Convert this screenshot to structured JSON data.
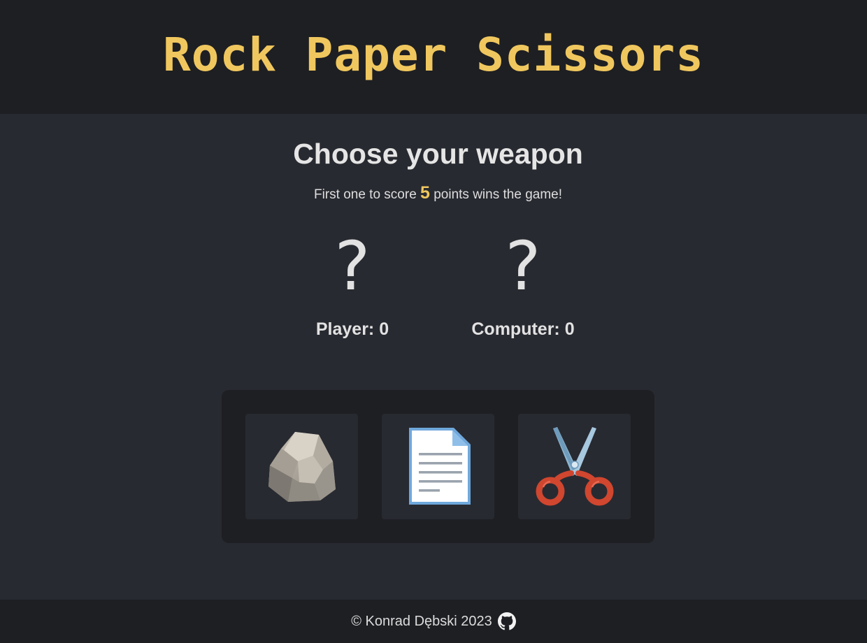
{
  "header": {
    "title": "Rock Paper Scissors"
  },
  "main": {
    "heading": "Choose your weapon",
    "rule_prefix": "First one to score",
    "win_points": "5",
    "rule_suffix": "points wins the game!"
  },
  "scoreboard": {
    "player": {
      "choice": "?",
      "label": "Player: 0"
    },
    "computer": {
      "choice": "?",
      "label": "Computer: 0"
    }
  },
  "weapons": [
    {
      "name": "rock",
      "icon": "rock-icon"
    },
    {
      "name": "paper",
      "icon": "paper-icon"
    },
    {
      "name": "scissors",
      "icon": "scissors-icon"
    }
  ],
  "footer": {
    "copyright": "© Konrad Dębski 2023",
    "link_icon": "github-icon"
  },
  "colors": {
    "accent": "#f0c75e",
    "header_bg": "#1e1f23",
    "page_bg": "#282a31",
    "text": "#e3e3e3"
  }
}
